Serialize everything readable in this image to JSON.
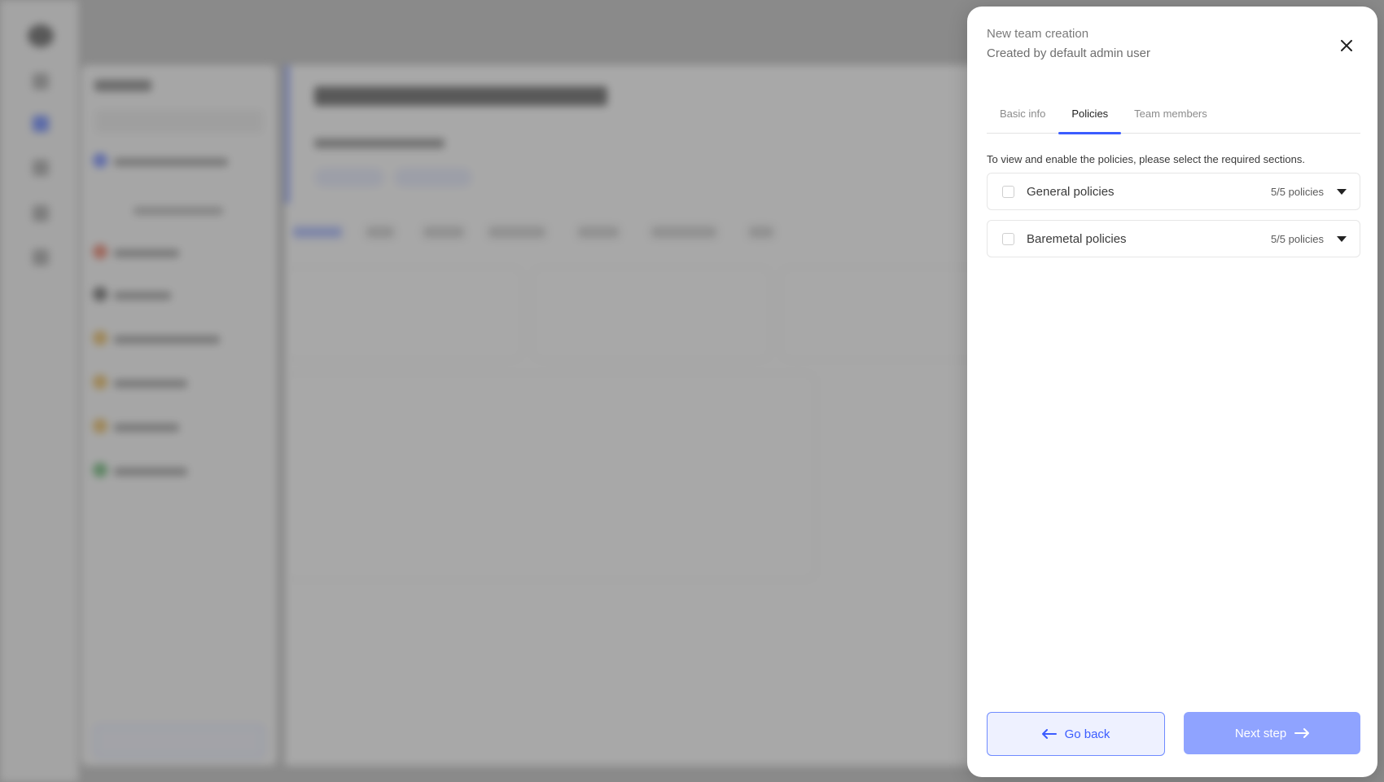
{
  "panel": {
    "title": "New team creation",
    "subtitle": "Created by default admin user",
    "close_icon": "close-icon"
  },
  "tabs": [
    {
      "label": "Basic info",
      "active": false
    },
    {
      "label": "Policies",
      "active": true
    },
    {
      "label": "Team members",
      "active": false
    }
  ],
  "policies": {
    "instructions": "To view and enable the policies, please select the required sections.",
    "sections": [
      {
        "name": "General policies",
        "count": "5/5 policies",
        "checked": false
      },
      {
        "name": "Baremetal policies",
        "count": "5/5 policies",
        "checked": false
      }
    ]
  },
  "footer": {
    "back_label": "Go back",
    "next_label": "Next step"
  },
  "colors": {
    "accent": "#3b5cff",
    "next_button_bg": "#8fa3ff",
    "back_button_bg": "#eef1ff"
  }
}
